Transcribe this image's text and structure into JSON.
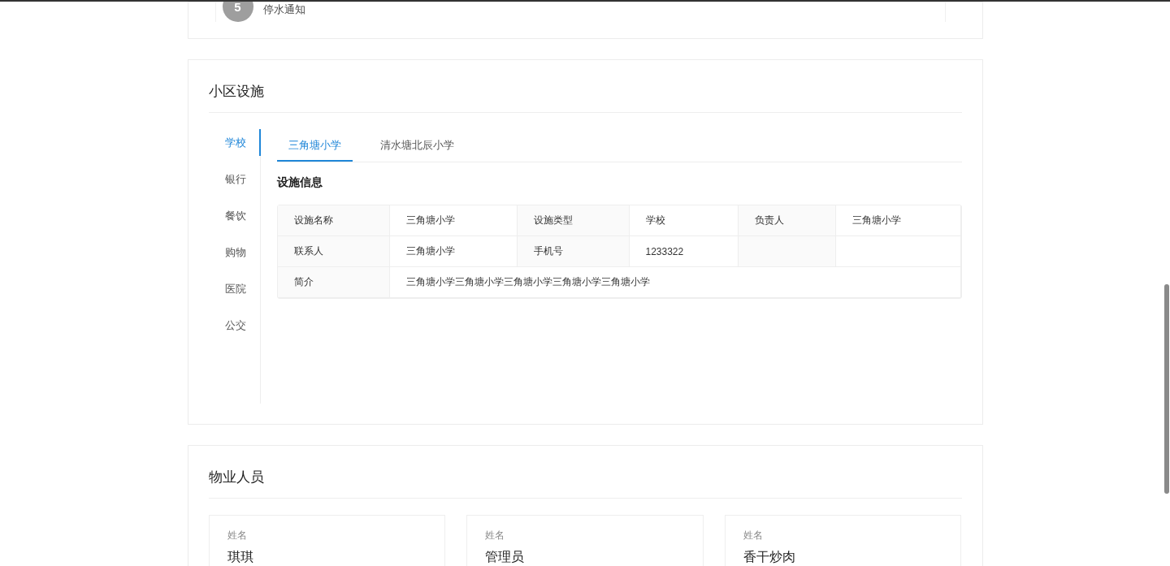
{
  "notice": {
    "index": "5",
    "title": "停水通知"
  },
  "facilities": {
    "title": "小区设施",
    "categories": [
      {
        "label": "学校",
        "selected": true
      },
      {
        "label": "银行",
        "selected": false
      },
      {
        "label": "餐饮",
        "selected": false
      },
      {
        "label": "购物",
        "selected": false
      },
      {
        "label": "医院",
        "selected": false
      },
      {
        "label": "公交",
        "selected": false
      }
    ],
    "tabs": [
      {
        "label": "三角塘小学",
        "selected": true
      },
      {
        "label": "清水塘北辰小学",
        "selected": false
      }
    ],
    "section_title": "设施信息",
    "table": {
      "rows": [
        [
          {
            "kind": "label",
            "text": "设施名称"
          },
          {
            "kind": "value",
            "text": "三角塘小学"
          },
          {
            "kind": "label",
            "text": "设施类型"
          },
          {
            "kind": "value",
            "text": "学校"
          },
          {
            "kind": "label",
            "text": "负责人"
          },
          {
            "kind": "value",
            "text": "三角塘小学"
          }
        ],
        [
          {
            "kind": "label",
            "text": "联系人"
          },
          {
            "kind": "value",
            "text": "三角塘小学"
          },
          {
            "kind": "label",
            "text": "手机号"
          },
          {
            "kind": "value",
            "text": "1233322"
          },
          {
            "kind": "label"
          },
          {
            "kind": "value"
          }
        ],
        [
          {
            "kind": "label",
            "text": "简介"
          },
          {
            "kind": "wide",
            "text": "三角塘小学三角塘小学三角塘小学三角塘小学三角塘小学"
          }
        ]
      ]
    }
  },
  "staff": {
    "title": "物业人员",
    "people": [
      {
        "label": "姓名",
        "name": "琪琪"
      },
      {
        "label": "姓名",
        "name": "管理员"
      },
      {
        "label": "姓名",
        "name": "香干炒肉"
      }
    ]
  }
}
